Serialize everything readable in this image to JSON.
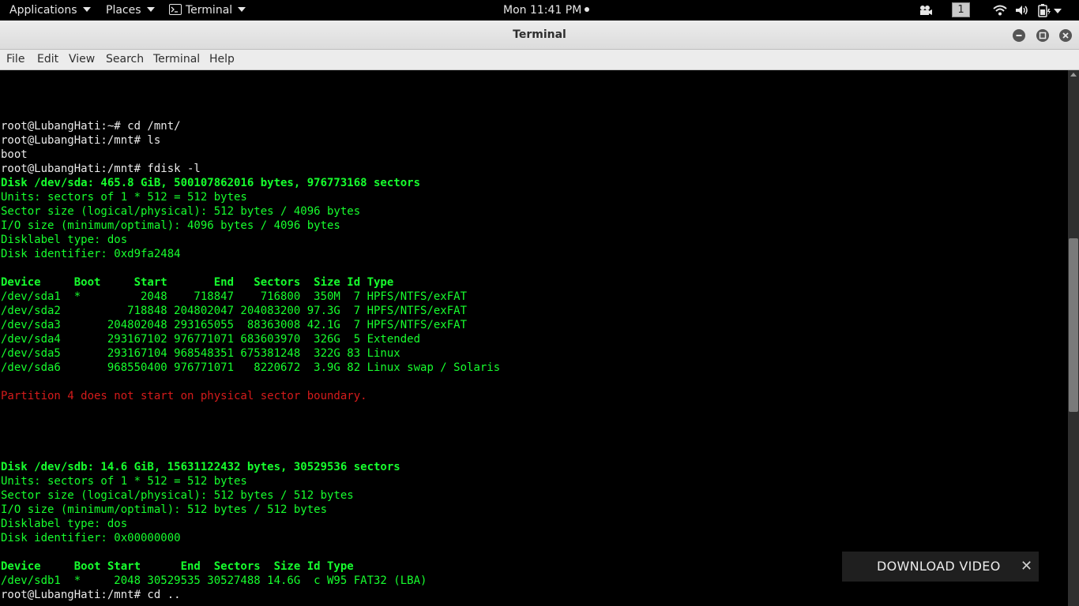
{
  "topbar": {
    "applications": "Applications",
    "places": "Places",
    "app_name": "Terminal",
    "clock": "Mon 11:41 PM",
    "workspace": "1",
    "icons": [
      "screencast-icon",
      "wifi-icon",
      "volume-icon",
      "battery-icon",
      "system-menu-caret-icon"
    ]
  },
  "window": {
    "title": "Terminal",
    "buttons": [
      "minimize-icon",
      "maximize-icon",
      "close-icon"
    ]
  },
  "menubar": [
    "File",
    "Edit",
    "View",
    "Search",
    "Terminal",
    "Help"
  ],
  "terminal": {
    "lines": [
      {
        "text": "root@LubangHati:~# cd /mnt/",
        "style": "plain"
      },
      {
        "text": "root@LubangHati:/mnt# ls",
        "style": "plain"
      },
      {
        "text": "boot",
        "style": "plain"
      },
      {
        "text": "root@LubangHati:/mnt# fdisk -l",
        "style": "plain"
      },
      {
        "text": "Disk /dev/sda: 465.8 GiB, 500107862016 bytes, 976773168 sectors",
        "style": "bold"
      },
      {
        "text": "Units: sectors of 1 * 512 = 512 bytes",
        "style": "green"
      },
      {
        "text": "Sector size (logical/physical): 512 bytes / 4096 bytes",
        "style": "green"
      },
      {
        "text": "I/O size (minimum/optimal): 4096 bytes / 4096 bytes",
        "style": "green"
      },
      {
        "text": "Disklabel type: dos",
        "style": "green"
      },
      {
        "text": "Disk identifier: 0xd9fa2484",
        "style": "green"
      },
      {
        "text": "",
        "style": "plain"
      },
      {
        "text": "Device     Boot     Start       End   Sectors  Size Id Type",
        "style": "bold"
      },
      {
        "text": "/dev/sda1  *         2048    718847    716800  350M  7 HPFS/NTFS/exFAT",
        "style": "green"
      },
      {
        "text": "/dev/sda2          718848 204802047 204083200 97.3G  7 HPFS/NTFS/exFAT",
        "style": "green"
      },
      {
        "text": "/dev/sda3       204802048 293165055  88363008 42.1G  7 HPFS/NTFS/exFAT",
        "style": "green"
      },
      {
        "text": "/dev/sda4       293167102 976771071 683603970  326G  5 Extended",
        "style": "green"
      },
      {
        "text": "/dev/sda5       293167104 968548351 675381248  322G 83 Linux",
        "style": "green"
      },
      {
        "text": "/dev/sda6       968550400 976771071   8220672  3.9G 82 Linux swap / Solaris",
        "style": "green"
      },
      {
        "text": "",
        "style": "plain"
      },
      {
        "text": "Partition 4 does not start on physical sector boundary.",
        "style": "red"
      },
      {
        "text": "",
        "style": "plain"
      },
      {
        "text": "",
        "style": "plain"
      },
      {
        "text": "",
        "style": "plain"
      },
      {
        "text": "",
        "style": "plain"
      },
      {
        "text": "Disk /dev/sdb: 14.6 GiB, 15631122432 bytes, 30529536 sectors",
        "style": "bold"
      },
      {
        "text": "Units: sectors of 1 * 512 = 512 bytes",
        "style": "green"
      },
      {
        "text": "Sector size (logical/physical): 512 bytes / 512 bytes",
        "style": "green"
      },
      {
        "text": "I/O size (minimum/optimal): 512 bytes / 512 bytes",
        "style": "green"
      },
      {
        "text": "Disklabel type: dos",
        "style": "green"
      },
      {
        "text": "Disk identifier: 0x00000000",
        "style": "green"
      },
      {
        "text": "",
        "style": "plain"
      },
      {
        "text": "Device     Boot Start      End  Sectors  Size Id Type",
        "style": "bold"
      },
      {
        "text": "/dev/sdb1  *     2048 30529535 30527488 14.6G  c W95 FAT32 (LBA)",
        "style": "green"
      },
      {
        "text": "root@LubangHati:/mnt# cd ..",
        "style": "plain"
      }
    ]
  },
  "download_banner": {
    "label": "DOWNLOAD VIDEO",
    "close": "✕"
  }
}
